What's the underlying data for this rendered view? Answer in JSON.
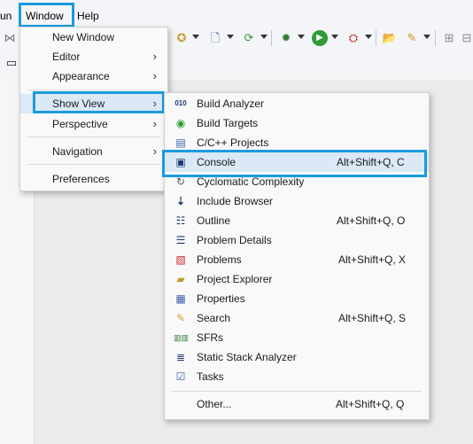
{
  "menubar": {
    "run_partial": "un",
    "window": "Window",
    "help": "Help"
  },
  "window_menu": {
    "items": [
      "New Window",
      "Editor",
      "Appearance",
      "Show View",
      "Perspective",
      "Navigation",
      "Preferences"
    ]
  },
  "show_view_menu": {
    "items": [
      {
        "label": "Build Analyzer",
        "accel": ""
      },
      {
        "label": "Build Targets",
        "accel": ""
      },
      {
        "label": "C/C++ Projects",
        "accel": ""
      },
      {
        "label": "Console",
        "accel": "Alt+Shift+Q, C"
      },
      {
        "label": "Cyclomatic Complexity",
        "accel": ""
      },
      {
        "label": "Include Browser",
        "accel": ""
      },
      {
        "label": "Outline",
        "accel": "Alt+Shift+Q, O"
      },
      {
        "label": "Problem Details",
        "accel": ""
      },
      {
        "label": "Problems",
        "accel": "Alt+Shift+Q, X"
      },
      {
        "label": "Project Explorer",
        "accel": ""
      },
      {
        "label": "Properties",
        "accel": ""
      },
      {
        "label": "Search",
        "accel": "Alt+Shift+Q, S"
      },
      {
        "label": "SFRs",
        "accel": ""
      },
      {
        "label": "Static Stack Analyzer",
        "accel": ""
      },
      {
        "label": "Tasks",
        "accel": ""
      },
      {
        "label": "Other...",
        "accel": "Alt+Shift+Q, Q"
      }
    ]
  },
  "colors": {
    "highlight": "#1a9be0",
    "selection": "#dbe9f7"
  }
}
